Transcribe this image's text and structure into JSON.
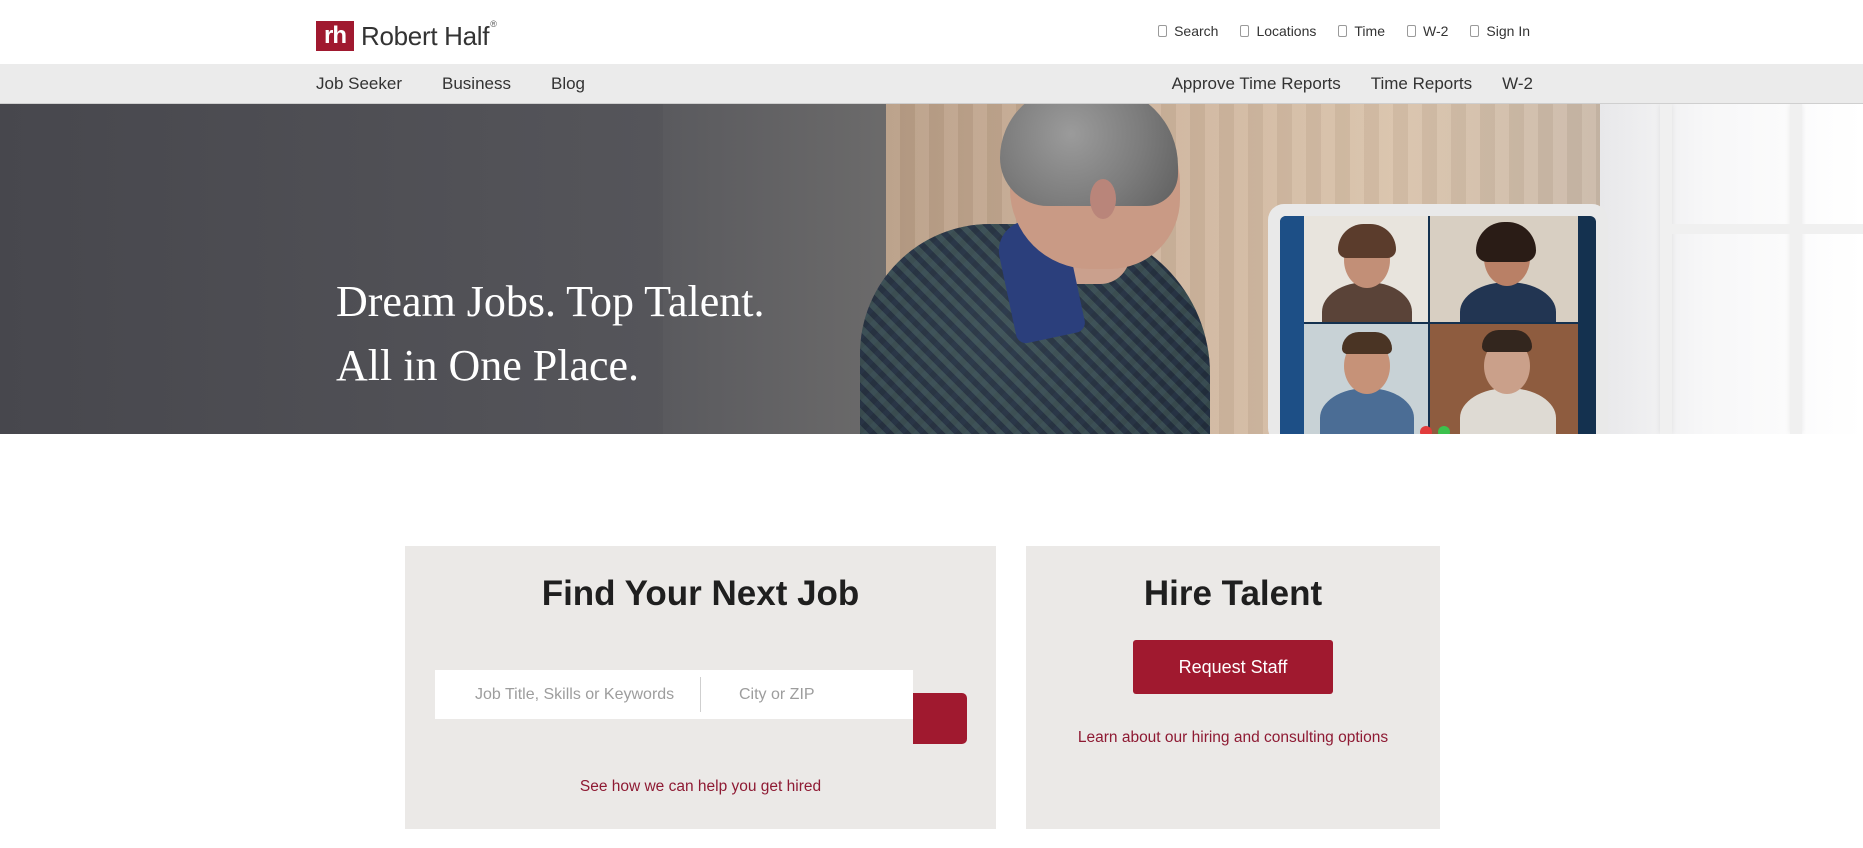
{
  "brand": {
    "name": "Robert Half",
    "mark": "rh",
    "registered": "®",
    "color": "#a0192f"
  },
  "utility_nav": [
    {
      "label": "Search"
    },
    {
      "label": "Locations"
    },
    {
      "label": "Time"
    },
    {
      "label": "W-2"
    },
    {
      "label": "Sign In"
    }
  ],
  "main_nav": {
    "left": [
      {
        "label": "Job Seeker"
      },
      {
        "label": "Business"
      },
      {
        "label": "Blog"
      }
    ],
    "right": [
      {
        "label": "Approve Time Reports"
      },
      {
        "label": "Time Reports"
      },
      {
        "label": "W-2"
      }
    ]
  },
  "hero": {
    "line1": "Dream Jobs. Top Talent.",
    "line2": "All in One Place."
  },
  "job_card": {
    "title": "Find Your Next Job",
    "keyword_placeholder": "Job Title, Skills or Keywords",
    "location_placeholder": "City or ZIP",
    "link": "See how we can help you get hired"
  },
  "hire_card": {
    "title": "Hire Talent",
    "button": "Request Staff",
    "link": "Learn about our hiring and consulting options"
  }
}
